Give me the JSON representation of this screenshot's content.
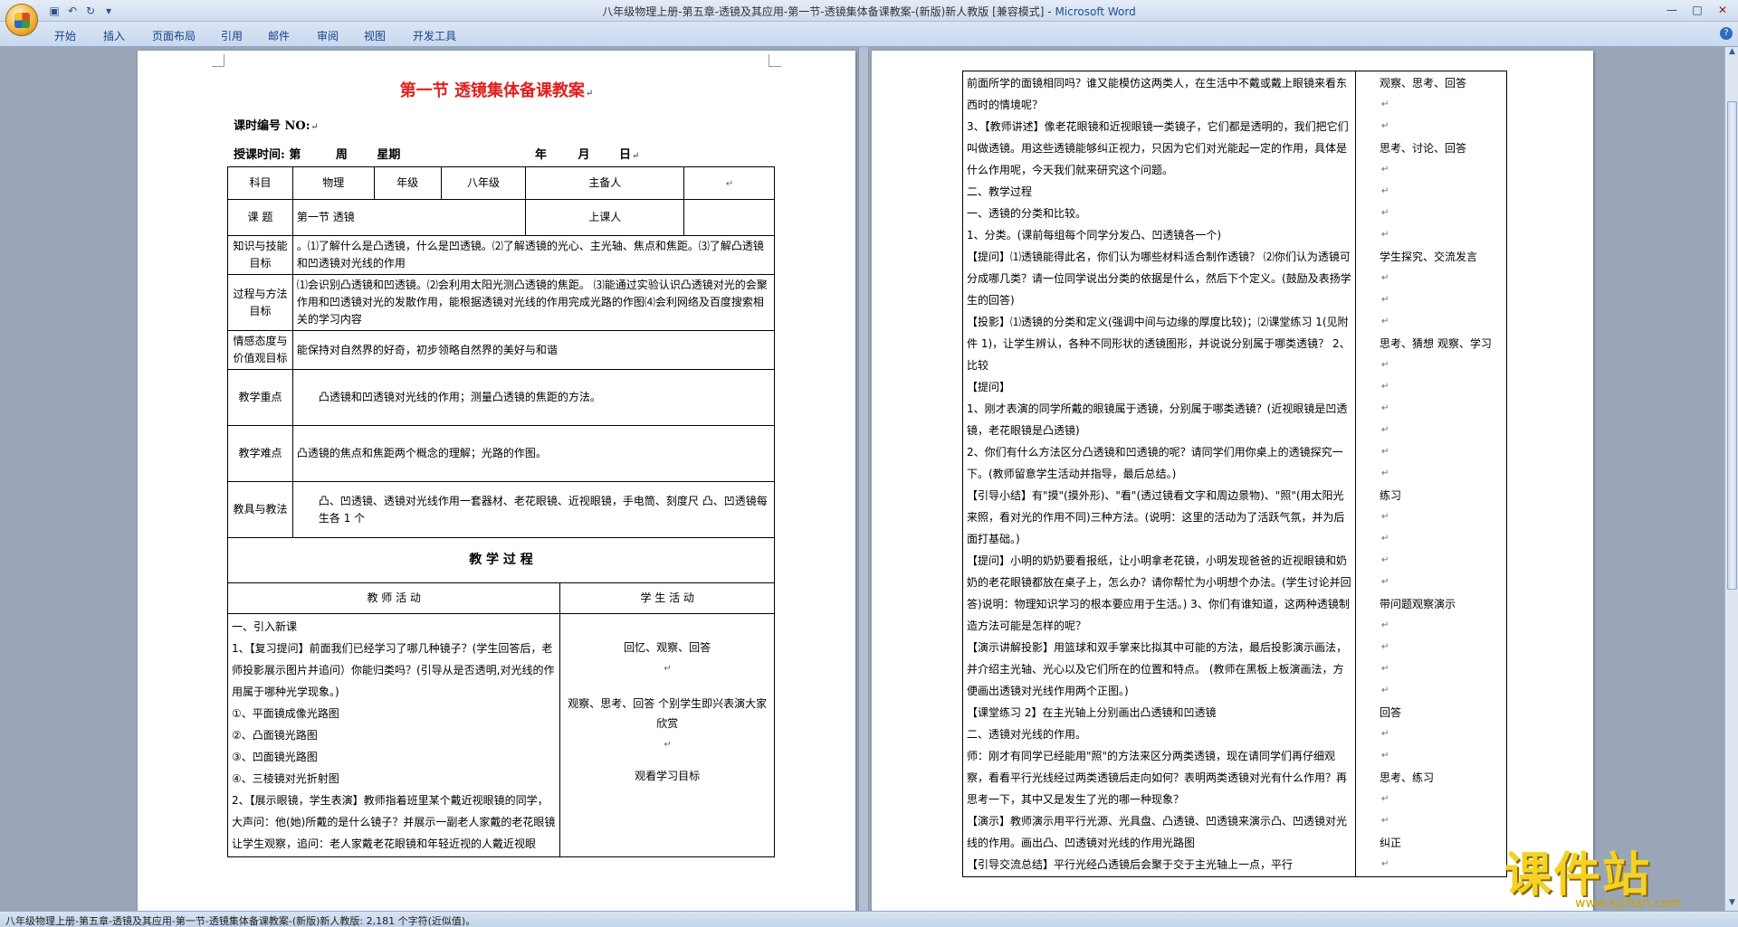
{
  "window": {
    "title_doc": "八年级物理上册-第五章-透镜及其应用-第一节-透镜集体备课教案-(新版)新人教版 [兼容模式]",
    "title_app": "Microsoft Word",
    "qat": {
      "save": "▣",
      "undo": "↶",
      "redo": "↻",
      "more": "▾"
    },
    "controls": {
      "minimize": "—",
      "maximize": "□",
      "close": "✕"
    }
  },
  "ribbon": {
    "tabs": [
      "开始",
      "插入",
      "页面布局",
      "引用",
      "邮件",
      "审阅",
      "视图",
      "开发工具"
    ],
    "help": "?"
  },
  "left_page": {
    "title": "第一节  透镜集体备课教案",
    "lesson_no": "课时编号  NO:",
    "teach_time": {
      "label": "授课时间: 第",
      "week": "周",
      "weekday": "星期",
      "year": "年",
      "month": "月",
      "day": "日"
    },
    "table": {
      "subject_label": "科目",
      "subject": "物理",
      "grade_label": "年级",
      "grade": "八年级",
      "preparer_label": "主备人",
      "topic_label": "课  题",
      "topic": "第一节 透镜",
      "lecturer_label": "上课人",
      "rows": [
        {
          "label": "知识与技能目标",
          "text": "。⑴了解什么是凸透镜，什么是凹透镜。⑵了解透镜的光心、主光轴、焦点和焦距。⑶了解凸透镜和凹透镜对光线的作用"
        },
        {
          "label": "过程与方法目标",
          "text": "⑴会识别凸透镜和凹透镜。⑵会利用太阳光测凸透镜的焦距。 ⑶能通过实验认识凸透镜对光的会聚作用和凹透镜对光的发散作用，能根据透镜对光线的作用完成光路的作图⑷会利网络及百度搜索相关的学习内容"
        },
        {
          "label": "情感态度与价值观目标",
          "text": "能保持对自然界的好奇，初步领略自然界的美好与和谐"
        },
        {
          "label": "教学重点",
          "text": "凸透镜和凹透镜对光线的作用；测量凸透镜的焦距的方法。"
        },
        {
          "label": "教学难点",
          "text": "凸透镜的焦点和焦距两个概念的理解；光路的作图。"
        },
        {
          "label": "教具与教法",
          "text": "凸、凹透镜、透镜对光线作用一套器材、老花眼镜、近视眼镜，手电筒、刻度尺 凸、凹透镜每生各 1 个"
        }
      ],
      "process_header": "教    学    过    程",
      "teacher_header": "教  师  活  动",
      "student_header": "学  生  活  动",
      "teacher_lines": [
        "一、引入新课",
        "1、【复习提问】前面我们已经学习了哪几种镜子？(学生回答后，老师投影展示图片并追问）你能归类吗？(引导从是否透明,对光线的作用属于哪种光学现象。)",
        "①、平面镜成像光路图",
        "②、凸面镜光路图",
        "③、凹面镜光路图",
        "④、三棱镜对光折射图",
        "2、【展示眼镜，学生表演】教师指着班里某个戴近视眼镜的同学，大声问：他(她)所戴的是什么镜子？并展示一副老人家戴的老花眼镜让学生观察，追问：老人家戴老花眼镜和年轻近视的人戴近视眼镜，与"
      ],
      "student_lines": [
        "回忆、观察、回答",
        "观察、思考、回答   个别学生即兴表演大家欣赏",
        "观看学习目标"
      ]
    }
  },
  "right_page": {
    "teacher_lines": [
      "前面所学的面镜相同吗？谁又能模仿这两类人，在生活中不戴或戴上眼镜来看东西时的情境呢？",
      "3、【教师讲述】像老花眼镜和近视眼镜一类镜子，它们都是透明的，我们把它们叫做透镜。用这些透镜能够纠正视力，只因为它们对光能起一定的作用，具体是什么作用呢，今天我们就来研究这个问题。",
      "二、教学过程",
      "一、透镜的分类和比较。",
      "1、分类。(课前每组每个同学分发凸、凹透镜各一个)",
      "【提问】⑴透镜能得此名，你们认为哪些材料适合制作透镜？ ⑵你们认为透镜可分成哪几类？请一位同学说出分类的依据是什么，然后下个定义。(鼓励及表扬学生的回答)",
      "【投影】⑴透镜的分类和定义(强调中间与边缘的厚度比较)；⑵课堂练习 1(见附件 1)，让学生辨认，各种不同形状的透镜图形，并说说分别属于哪类透镜？ 2、比较",
      "【提问】",
      "1、刚才表演的同学所戴的眼镜属于透镜，分别属于哪类透镜？(近视眼镜是凹透镜，老花眼镜是凸透镜)",
      "2、你们有什么方法区分凸透镜和凹透镜的呢？请同学们用你桌上的透镜探究一下。(教师留意学生活动并指导，最后总结。)",
      "【引导小结】有\"摸\"(摸外形)、\"看\"(透过镜看文字和周边景物)、\"照\"(用太阳光来照，看对光的作用不同)三种方法。(说明：这里的活动为了活跃气氛，并为后面打基础。)",
      "【提问】小明的奶奶要看报纸，让小明拿老花镜，小明发现爸爸的近视眼镜和奶奶的老花眼镜都放在桌子上，怎么办？请你帮忙为小明想个办法。(学生讨论并回答)说明：物理知识学习的根本要应用于生活。) 3、你们有谁知道，这两种透镜制造方法可能是怎样的呢？",
      "【演示讲解投影】用篮球和双手掌来比拟其中可能的方法，最后投影演示画法，并介绍主光轴、光心以及它们所在的位置和特点。 (教师在黑板上板演画法，方便画出透镜对光线作用两个正图。)",
      "【课堂练习 2】在主光轴上分别画出凸透镜和凹透镜",
      "  二、透镜对光线的作用。",
      "      师：刚才有同学已经能用\"照\"的方法来区分两类透镜，现在请同学们再仔细观察，看看平行光线经过两类透镜后走向如何？表明两类透镜对光有什么作用？再思考一下，其中又是发生了光的哪一种现象？",
      "【演示】教师演示用平行光源、光具盘、凸透镜、凹透镜来演示凸、凹透镜对光线的作用。画出凸、凹透镜对光线的作用光路图",
      "【引导交流总结】平行光经凸透镜后会聚于交于主光轴上一点，平行"
    ],
    "student_col": [
      {
        "line": 0,
        "text": "观察、思考、回答"
      },
      {
        "line": 3,
        "text": "思考、讨论、回答"
      },
      {
        "line": 8,
        "text": "学生探究、交流发言"
      },
      {
        "line": 12,
        "text": "思考、猜想 观察、学习"
      },
      {
        "line": 19,
        "text": "练习"
      },
      {
        "line": 24,
        "text": "带问题观察演示"
      },
      {
        "line": 29,
        "text": "回答"
      },
      {
        "line": 32,
        "text": "思考、练习"
      },
      {
        "line": 35,
        "text": "纠正"
      }
    ]
  },
  "status": {
    "text": "八年级物理上册-第五章-透镜及其应用-第一节-透镜集体备课教案-(新版)新人教版: 2,181 个字符(近似值)。"
  },
  "watermark": {
    "big": "课件站",
    "url": "www.kjzhan.com"
  },
  "return_mark": "↵"
}
